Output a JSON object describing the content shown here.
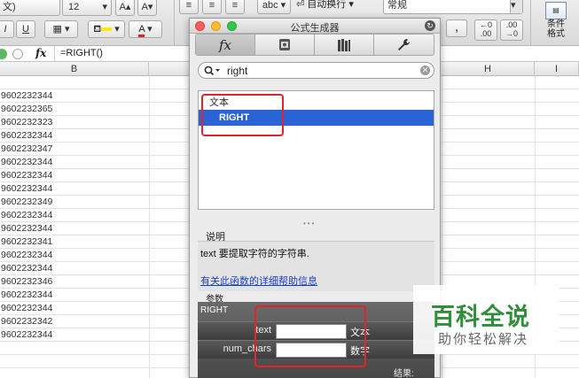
{
  "ribbon": {
    "font_name_partial": "文)",
    "font_size": "12",
    "italic": "I",
    "underline": "U",
    "wrap_text_label": "自动换行",
    "number_format": "常规",
    "wrap_dropdown": "▾",
    "abc_label": "abc",
    "comma_label": ",",
    "dec_inc_top": "←0",
    "dec_inc_bottom": ".00",
    "dec_dec_top": ".00",
    "dec_dec_bottom": "→0",
    "cond_format_line1": "条件",
    "cond_format_line2": "格式"
  },
  "formula_bar": {
    "fx_label": "fx",
    "formula": "=RIGHT()"
  },
  "columns": [
    "B",
    "H",
    "I"
  ],
  "cells": [
    "9602232344",
    "9602232365",
    "9602232323",
    "9602232344",
    "9602232347",
    "9602232344",
    "9602232344",
    "9602232344",
    "9602232349",
    "9602232344",
    "9602232344",
    "9602232341",
    "9602232344",
    "9602232344",
    "9602232346",
    "9602232344",
    "9602232344",
    "9602232342",
    "9602232344"
  ],
  "panel": {
    "title": "公式生成器",
    "tabs": [
      {
        "label": "fx"
      },
      {
        "label": ""
      },
      {
        "label": ""
      },
      {
        "label": ""
      }
    ],
    "search_value": "right",
    "category": "文本",
    "selected_function": "RIGHT",
    "description_title": "说明",
    "description": "text 要提取字符的字符串.",
    "help_link": "有关此函数的详细帮助信息",
    "params_title": "参数",
    "param_function": "RIGHT",
    "params": [
      {
        "label": "text",
        "value": "",
        "type": "文本"
      },
      {
        "label": "num_chars",
        "value": "",
        "type": "数字"
      }
    ],
    "result_label": "结果:"
  },
  "watermark": {
    "title": "百科全说",
    "subtitle": "助你轻松解决"
  },
  "colors": {
    "selection": "#2a63d4",
    "highlight": "#e4232b",
    "watermark_green": "#2f8f3a"
  }
}
